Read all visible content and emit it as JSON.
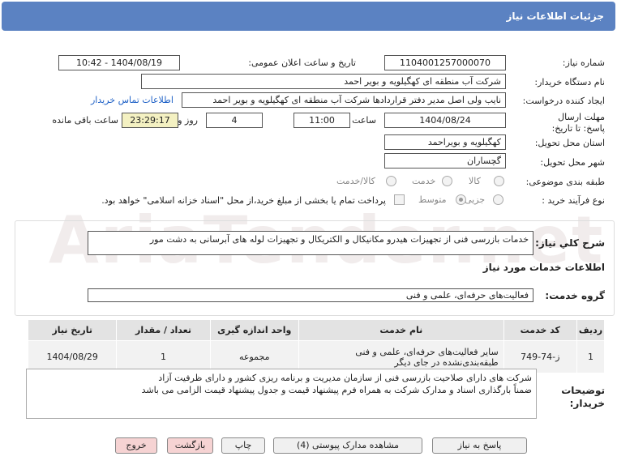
{
  "header": {
    "title": "جزئیات اطلاعات نیاز"
  },
  "form": {
    "need_number_label": "شماره نیاز:",
    "need_number": "1104001257000070",
    "announce_label": "تاریخ و ساعت اعلان عمومی:",
    "announce_value": "1404/08/19 - 10:42",
    "buyer_org_label": "نام دستگاه خریدار:",
    "buyer_org": "شرکت آب منطقه ای کهگیلویه و بویر احمد",
    "creator_label": "ایجاد کننده درخواست:",
    "creator": "نایب ولی اصل مدیر دفتر قراردادها شرکت آب منطقه ای کهگیلویه و بویر احمد",
    "contact_link": "اطلاعات تماس خریدار",
    "deadline_label": "مهلت ارسال پاسخ: تا تاریخ:",
    "deadline_date": "1404/08/24",
    "time_label": "ساعت",
    "deadline_time": "11:00",
    "days_value": "4",
    "days_label": "روز و",
    "remaining_time": "23:29:17",
    "remaining_label": "ساعت باقی مانده",
    "province_label": "استان محل تحویل:",
    "province": "کهگیلویه و بویراحمد",
    "city_label": "شهر محل تحویل:",
    "city": "گچساران",
    "category_label": "طبقه بندی موضوعی:",
    "category_options": [
      "کالا",
      "خدمت",
      "کالا/خدمت"
    ],
    "process_label": "نوع فرآیند خرید :",
    "process_options": [
      "جزیی",
      "متوسط"
    ],
    "payment_note": "پرداخت تمام یا بخشی از مبلغ خرید،از محل \"اسناد خزانه اسلامی\" خواهد بود."
  },
  "summary": {
    "label": "شرح کلي نیاز:",
    "text": "خدمات بازرسی فنی از تجهیزات هیدرو مکانیکال و الکتریکال و تجهیزات لوله های آبرسانی به دشت مور"
  },
  "services": {
    "section_title": "اطلاعات خدمات مورد نیاز",
    "group_label": "گروه خدمت:",
    "group_value": "فعالیت‌های حرفه‌ای، علمی و فنی",
    "columns": [
      "ردیف",
      "کد خدمت",
      "نام خدمت",
      "واحد اندازه گیری",
      "تعداد / مقدار",
      "تاریخ نیاز"
    ],
    "rows": [
      [
        "1",
        "ز-74-749",
        "سایر فعالیت‌های حرفه‌ای، علمی و فنی طبقه‌بندی‌نشده در جای دیگر",
        "مجموعه",
        "1",
        "1404/08/29"
      ]
    ]
  },
  "notes": {
    "label": "توضیحات خریدار:",
    "line1": "شرکت های دارای صلاحیت بازرسی فنی از سازمان مدیریت و برنامه ریزی کشور و دارای ظرفیت آزاد",
    "line2": "ضمناً بارگذاری اسناد و مدارک شرکت به همراه فرم پیشنهاد قیمت و جدول پیشنهاد قیمت الزامی می باشد"
  },
  "buttons": {
    "reply": "پاسخ به نیاز",
    "attachments": "مشاهده مدارک پیوستی (4)",
    "print": "چاپ",
    "back": "بازگشت",
    "exit": "خروج"
  },
  "watermark": "AriaTender.net"
}
